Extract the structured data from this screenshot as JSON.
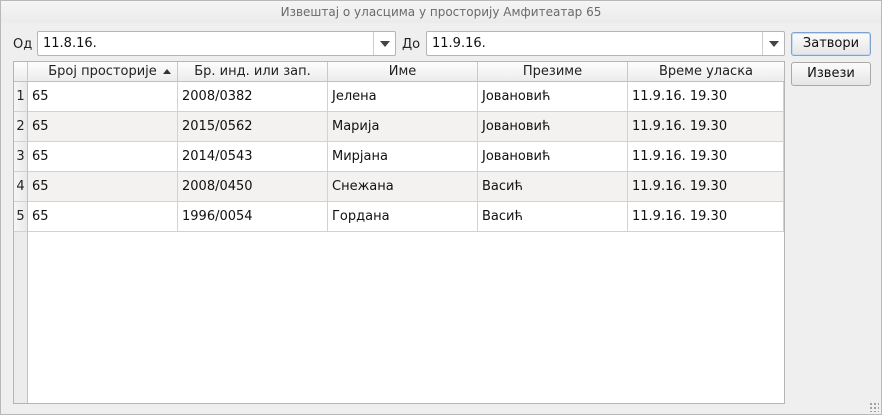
{
  "window": {
    "title": "Извештај о уласцима у просторију Амфитеатар 65"
  },
  "filters": {
    "from_label": "Од",
    "from_value": "11.8.16.",
    "to_label": "До",
    "to_value": "11.9.16."
  },
  "buttons": {
    "close_label": "Затвори",
    "export_label": "Извези"
  },
  "table": {
    "columns": [
      "Број просторије",
      "Бр. инд. или зап.",
      "Име",
      "Презиме",
      "Време уласка"
    ],
    "sorted_column": 0,
    "sort_direction": "ascending",
    "rows": [
      {
        "num": "1",
        "room": "65",
        "index": "2008/0382",
        "first": "Јелена",
        "last": "Јовановић",
        "time": "11.9.16. 19.30"
      },
      {
        "num": "2",
        "room": "65",
        "index": "2015/0562",
        "first": "Марија",
        "last": "Јовановић",
        "time": "11.9.16. 19.30"
      },
      {
        "num": "3",
        "room": "65",
        "index": "2014/0543",
        "first": "Мирјана",
        "last": "Јовановић",
        "time": "11.9.16. 19.30"
      },
      {
        "num": "4",
        "room": "65",
        "index": "2008/0450",
        "first": "Снежана",
        "last": "Васић",
        "time": "11.9.16. 19.30"
      },
      {
        "num": "5",
        "room": "65",
        "index": "1996/0054",
        "first": "Гордана",
        "last": "Васић",
        "time": "11.9.16. 19.30"
      }
    ]
  }
}
